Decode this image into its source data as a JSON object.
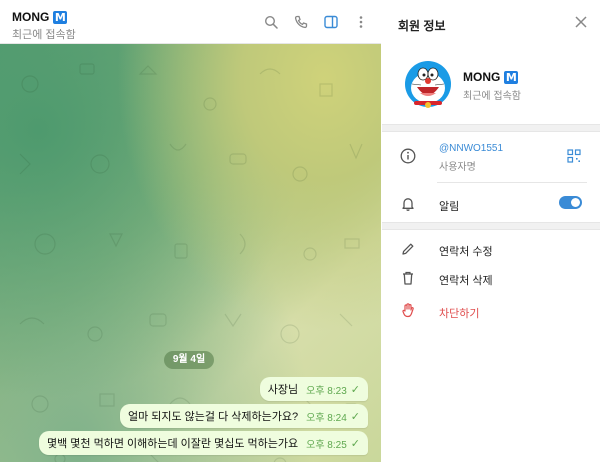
{
  "chat": {
    "title": "MONG",
    "badge": "M",
    "status": "최근에 접속함",
    "date_chip": "9월 4일",
    "messages": [
      {
        "text": "사장님",
        "time": "오후 8:23",
        "check": "✓"
      },
      {
        "text": "얼마 되지도 않는걸 다 삭제하는가요?",
        "time": "오후 8:24",
        "check": "✓"
      },
      {
        "text": "몇백 몇천 먹하면 이해하는데 이잘란 몇십도 먹하는가요",
        "time": "오후 8:25",
        "check": "✓"
      }
    ]
  },
  "header_icons": [
    "search-icon",
    "phone-icon",
    "sidebar-toggle-icon",
    "more-vertical-icon"
  ],
  "info": {
    "title": "회원 정보",
    "profile_name": "MONG",
    "profile_badge": "M",
    "profile_status": "최근에 접속함",
    "username": "@NNWO1551",
    "username_label": "사용자명",
    "notifications_label": "알림",
    "notifications_on": true,
    "edit_contact": "연락처 수정",
    "delete_contact": "연락처 삭제",
    "block": "차단하기"
  },
  "colors": {
    "accent": "#3a8bd6",
    "bubble": "#effdde",
    "check": "#5fa84f",
    "danger": "#e04e4e"
  }
}
